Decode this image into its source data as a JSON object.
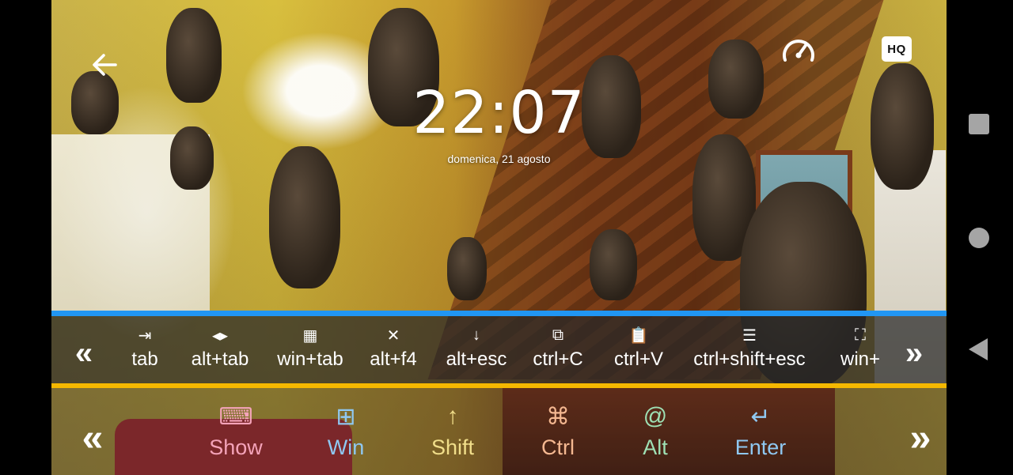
{
  "lockscreen": {
    "time": "22:07",
    "date": "domenica, 21 agosto"
  },
  "top_controls": {
    "back_icon": "arrow-left-icon",
    "speed_icon": "speedometer-icon",
    "quality_label": "HQ"
  },
  "shortcuts": {
    "items": [
      {
        "icon": "tab-icon",
        "glyph": "⇥",
        "label": "tab"
      },
      {
        "icon": "alt-tab-icon",
        "glyph": "◂▸",
        "label": "alt+tab"
      },
      {
        "icon": "grid-icon",
        "glyph": "▦",
        "label": "win+tab"
      },
      {
        "icon": "close-icon",
        "glyph": "✕",
        "label": "alt+f4"
      },
      {
        "icon": "arrow-down-icon",
        "glyph": "↓",
        "label": "alt+esc"
      },
      {
        "icon": "copy-icon",
        "glyph": "⧉",
        "label": "ctrl+C"
      },
      {
        "icon": "clipboard-icon",
        "glyph": "📋",
        "label": "ctrl+V"
      },
      {
        "icon": "list-icon",
        "glyph": "☰",
        "label": "ctrl+shift+esc"
      },
      {
        "icon": "fullscreen-icon",
        "glyph": "⛶",
        "label": "win+"
      }
    ],
    "left_arrow": "«",
    "right_arrow": "»"
  },
  "modifiers": {
    "left_arrow": "«",
    "right_arrow": "»",
    "keys": [
      {
        "label": "Show",
        "icon": "keyboard-icon",
        "glyph": "⌨",
        "color": "#f4a3b9"
      },
      {
        "label": "Win",
        "icon": "windows-icon",
        "glyph": "⊞",
        "color": "#8fc8f2"
      },
      {
        "label": "Shift",
        "icon": "arrow-up-icon",
        "glyph": "↑",
        "color": "#f1de8a"
      },
      {
        "label": "Ctrl",
        "icon": "command-icon",
        "glyph": "⌘",
        "color": "#f5b891"
      },
      {
        "label": "Alt",
        "icon": "at-icon",
        "glyph": "@",
        "color": "#9ee0b4"
      },
      {
        "label": "Enter",
        "icon": "enter-icon",
        "glyph": "↵",
        "color": "#8fc8f2"
      }
    ]
  },
  "colors": {
    "shortcut_top_border": "#2196f3",
    "shortcut_bottom_border": "#f5b800"
  }
}
